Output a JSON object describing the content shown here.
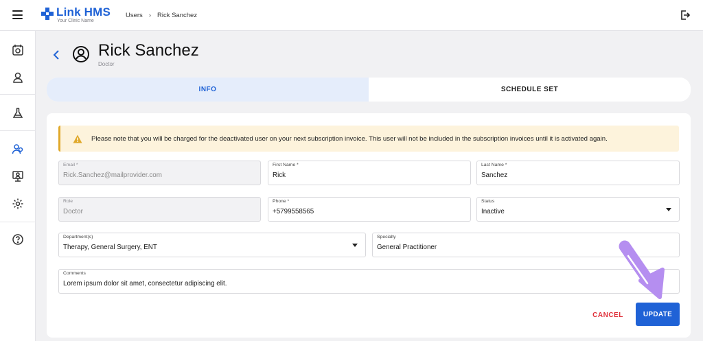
{
  "app": {
    "name": "Link HMS",
    "tagline": "Your Clinic Name"
  },
  "breadcrumb": {
    "parent": "Users",
    "separator": "›",
    "current": "Rick Sanchez"
  },
  "sidebar": {
    "items": [
      {
        "icon": "calendar-icon"
      },
      {
        "icon": "person-icon"
      },
      {
        "icon": "flask-icon"
      },
      {
        "icon": "users-icon",
        "active": true
      },
      {
        "icon": "monitor-user-icon"
      },
      {
        "icon": "gear-icon"
      },
      {
        "icon": "help-icon"
      }
    ]
  },
  "header": {
    "title": "Rick Sanchez",
    "subtitle": "Doctor"
  },
  "tabs": [
    {
      "label": "INFO",
      "active": true
    },
    {
      "label": "SCHEDULE SET",
      "active": false
    }
  ],
  "alert": {
    "text": "Please note that you will be charged for the deactivated user on your next subscription invoice. This user will not be included in the subscription invoices until it is activated again."
  },
  "form": {
    "email": {
      "label": "Email *",
      "value": "Rick.Sanchez@mailprovider.com"
    },
    "first_name": {
      "label": "First Name *",
      "value": "Rick"
    },
    "last_name": {
      "label": "Last Name *",
      "value": "Sanchez"
    },
    "role": {
      "label": "Role",
      "value": "Doctor"
    },
    "phone": {
      "label": "Phone *",
      "value": "+5799558565"
    },
    "status": {
      "label": "Status",
      "value": "Inactive"
    },
    "departments": {
      "label": "Department(s)",
      "value": "Therapy, General Surgery, ENT"
    },
    "specialty": {
      "label": "Specialty",
      "value": "General Practitioner"
    },
    "comments": {
      "label": "Comments",
      "value": "Lorem ipsum dolor sit amet, consectetur adipiscing elit."
    }
  },
  "actions": {
    "cancel_label": "CANCEL",
    "update_label": "UPDATE"
  },
  "colors": {
    "primary": "#1f62d6",
    "danger": "#e0303a",
    "alert_bg": "#fdf3dc",
    "alert_border": "#e0a92b",
    "annotation_arrow": "#b58ef0"
  }
}
